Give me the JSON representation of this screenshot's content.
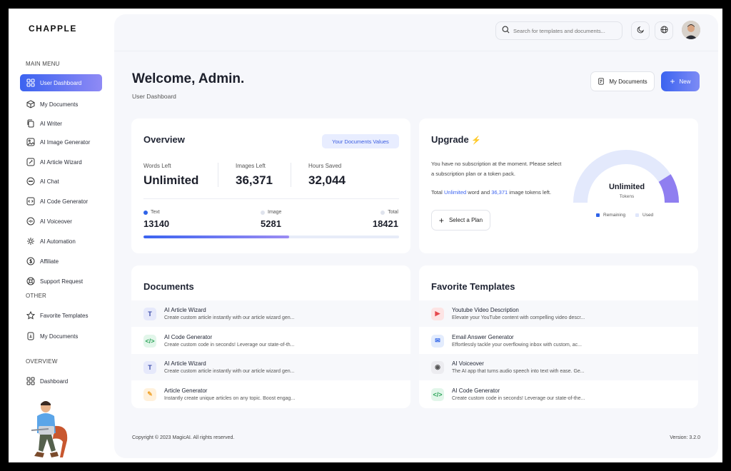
{
  "app": {
    "logo": "CHAPPLE"
  },
  "sidebar": {
    "main_menu_heading": "MAIN MENU",
    "other_heading": "OTHER",
    "overview_heading": "OVERVIEW",
    "items": [
      {
        "label": "User Dashboard",
        "icon": "grid-icon",
        "active": true
      },
      {
        "label": "My Documents",
        "icon": "box-icon"
      },
      {
        "label": "AI Writer",
        "icon": "copy-icon"
      },
      {
        "label": "AI Image Generator",
        "icon": "image-icon"
      },
      {
        "label": "AI Article Wizard",
        "icon": "wand-icon"
      },
      {
        "label": "AI Chat",
        "icon": "chat-icon"
      },
      {
        "label": "AI Code Generator",
        "icon": "code-icon"
      },
      {
        "label": "AI Voiceover",
        "icon": "voice-icon"
      },
      {
        "label": "AI Automation",
        "icon": "automation-icon"
      },
      {
        "label": "Affiliate",
        "icon": "dollar-icon"
      },
      {
        "label": "Support Request",
        "icon": "lifebuoy-icon"
      }
    ],
    "other_items": [
      {
        "label": "Favorite Templates",
        "icon": "star-icon"
      },
      {
        "label": "My Documents",
        "icon": "file-icon"
      }
    ],
    "overview_items": [
      {
        "label": "Dashboard",
        "icon": "grid-icon"
      }
    ]
  },
  "topbar": {
    "search_placeholder": "Search for templates and documents..."
  },
  "header": {
    "title": "Welcome, Admin.",
    "subtitle": "User Dashboard",
    "my_documents_label": "My Documents",
    "new_label": "New"
  },
  "overview": {
    "title": "Overview",
    "badge": "Your Documents Values",
    "stats": [
      {
        "label": "Words Left",
        "value": "Unlimited"
      },
      {
        "label": "Images Left",
        "value": "36,371"
      },
      {
        "label": "Hours Saved",
        "value": "32,044"
      }
    ],
    "legend": [
      {
        "label": "Text",
        "value": "13140",
        "color": "#2f63e8"
      },
      {
        "label": "Image",
        "value": "5281",
        "color": "#dfe3ec"
      },
      {
        "label": "Total",
        "value": "18421",
        "color": "#dfe3ec"
      }
    ],
    "progress_fraction": 0.57
  },
  "upgrade": {
    "title": "Upgrade",
    "bolt": "⚡",
    "message": "You have no subscription at the moment. Please select a subscription plan or a token pack.",
    "total_prefix": "Total",
    "total_words": "Unlimited",
    "word_and": "word and",
    "total_images": "36,371",
    "tokens_suffix": "image tokens left.",
    "plan_button": "Select a Plan",
    "gauge_value": "Unlimited",
    "gauge_sub": "Tokens",
    "legend_remaining": "Remaining",
    "legend_used": "Used",
    "colors": {
      "remaining": "#2f63e8",
      "used": "#dfe6fb"
    }
  },
  "documents": {
    "title": "Documents",
    "rows": [
      {
        "title": "AI Article Wizard",
        "desc": "Create custom article instantly with our article wizard gen...",
        "icon": "T",
        "bg": "#e6e9fb",
        "fg": "#3b4ba8"
      },
      {
        "title": "AI Code Generator",
        "desc": "Create custom code in seconds! Leverage our state-of-th...",
        "icon": "</>",
        "bg": "#e2f6ea",
        "fg": "#2fa55b"
      },
      {
        "title": "AI Article Wizard",
        "desc": "Create custom article instantly with our article wizard gen...",
        "icon": "T",
        "bg": "#e6e9fb",
        "fg": "#3b4ba8"
      },
      {
        "title": "Article Generator",
        "desc": "Instantly create unique articles on any topic. Boost engag...",
        "icon": "✎",
        "bg": "#fff1dc",
        "fg": "#f0a22b"
      }
    ]
  },
  "favorites": {
    "title": "Favorite Templates",
    "rows": [
      {
        "title": "Youtube Video Description",
        "desc": "Elevate your YouTube content with compelling video descr...",
        "icon": "▶",
        "bg": "#fde4e4",
        "fg": "#e5484d"
      },
      {
        "title": "Email Answer Generator",
        "desc": "Effortlessly tackle your overflowing inbox with custom, ac...",
        "icon": "✉",
        "bg": "#e3ecfd",
        "fg": "#2f63e8"
      },
      {
        "title": "AI Voiceover",
        "desc": "The AI app that turns audio speech into text with ease. Ge...",
        "icon": "◉",
        "bg": "#ececf0",
        "fg": "#555"
      },
      {
        "title": "AI Code Generator",
        "desc": "Create custom code in seconds! Leverage our state-of-the...",
        "icon": "</>",
        "bg": "#e2f6ea",
        "fg": "#2fa55b"
      }
    ]
  },
  "footer": {
    "copyright": "Copyright © 2023 MagicAI. All rights reserved.",
    "version": "Version: 3.2.0"
  }
}
